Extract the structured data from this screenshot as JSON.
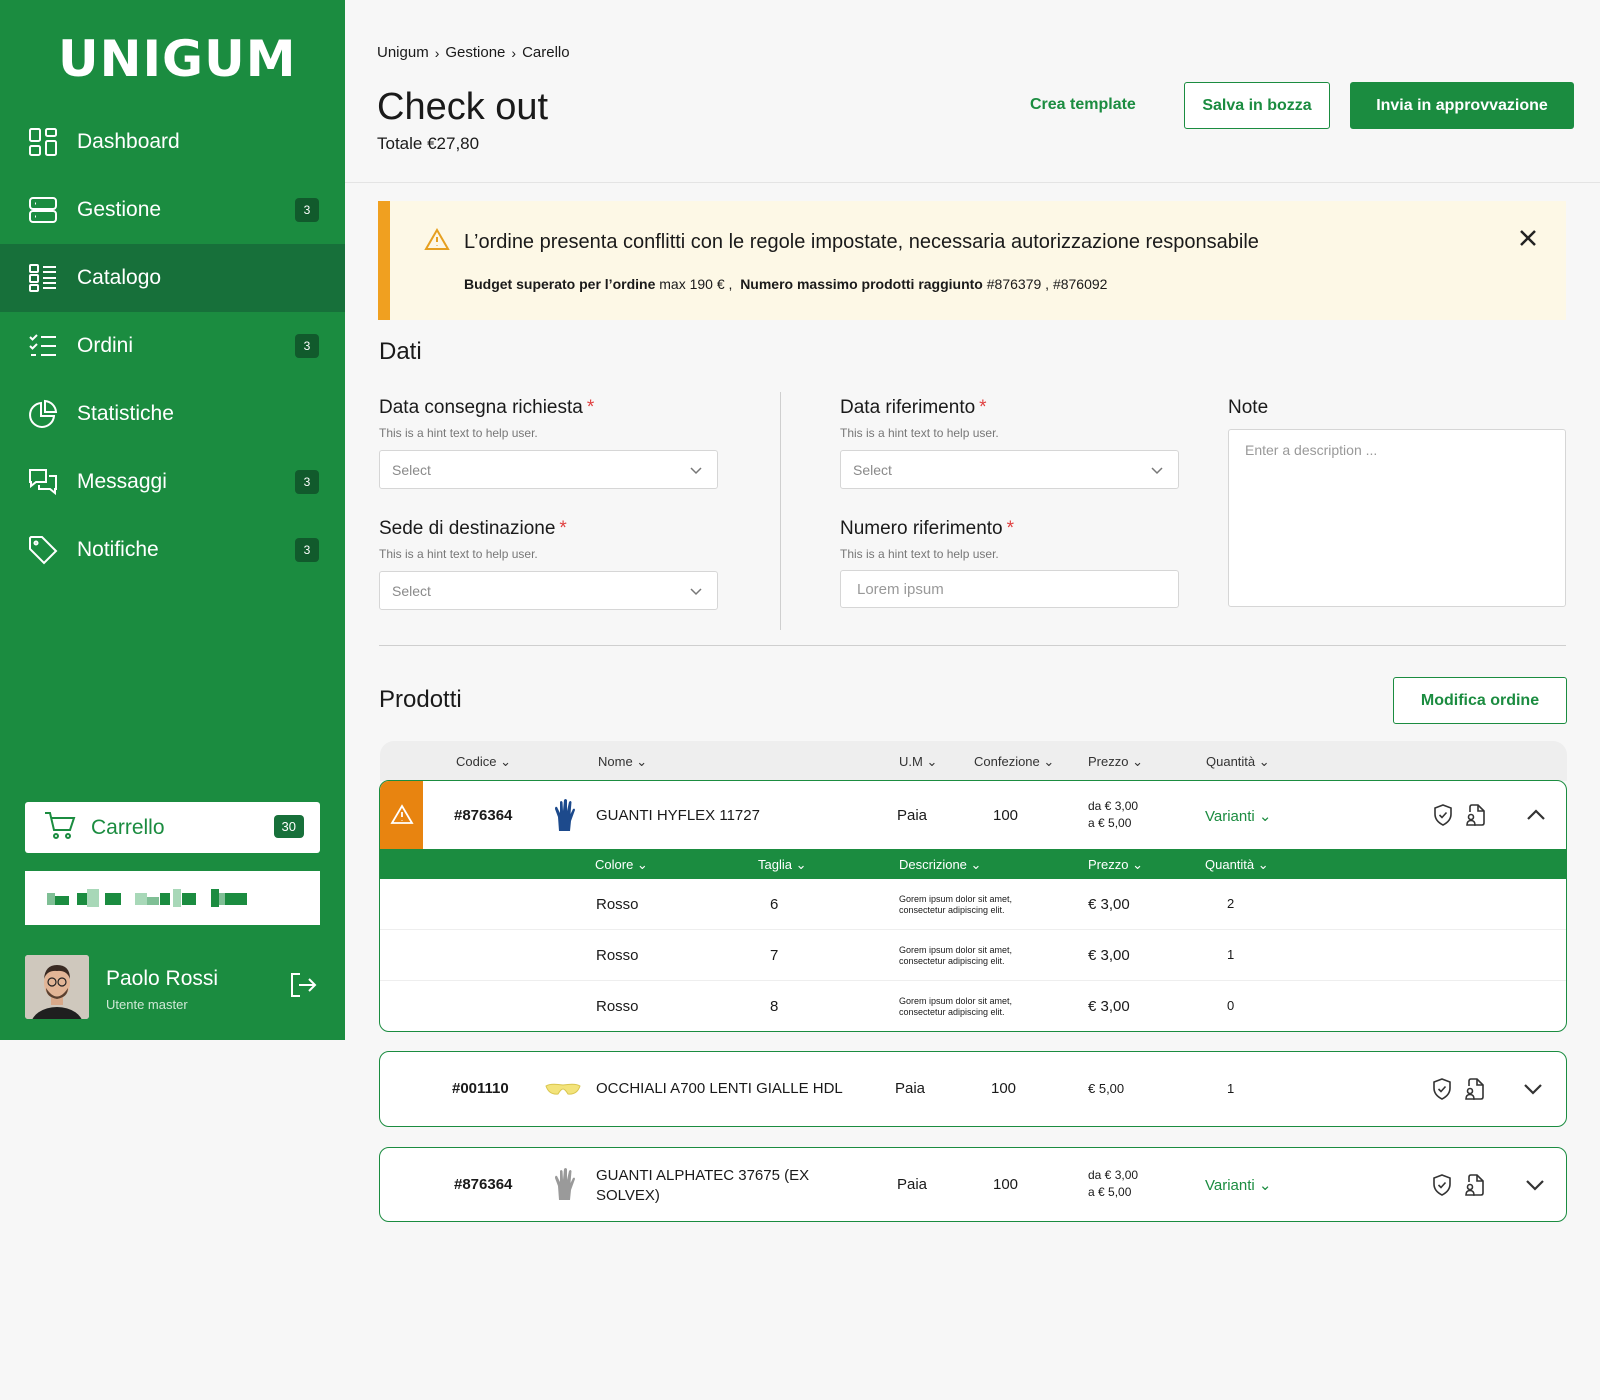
{
  "brand": {
    "logo": "UNIGUM",
    "accent": "#1b8c40"
  },
  "sidebar": {
    "items": [
      {
        "label": "Dashboard",
        "icon": "dashboard-icon",
        "badge": ""
      },
      {
        "label": "Gestione",
        "icon": "server-icon",
        "badge": "3"
      },
      {
        "label": "Catalogo",
        "icon": "list-icon",
        "badge": "",
        "active": true
      },
      {
        "label": "Ordini",
        "icon": "checklist-icon",
        "badge": "3"
      },
      {
        "label": "Statistiche",
        "icon": "pie-chart-icon",
        "badge": ""
      },
      {
        "label": "Messaggi",
        "icon": "chat-icon",
        "badge": "3"
      },
      {
        "label": "Notifiche",
        "icon": "tag-icon",
        "badge": "3"
      }
    ],
    "cart": {
      "label": "Carrello",
      "count": "30"
    },
    "user": {
      "name": "Paolo Rossi",
      "role": "Utente master"
    }
  },
  "header": {
    "breadcrumb": [
      "Unigum",
      "Gestione",
      "Carello"
    ],
    "title": "Check out",
    "total": "Totale €27,80",
    "actions": {
      "template": "Crea template",
      "draft": "Salva in bozza",
      "submit": "Invia in approvvazione"
    }
  },
  "alert": {
    "title": "L’ordine presenta conflitti con le regole impostate, necessaria autorizzazione responsabile",
    "budget_label": "Budget superato per l’ordine",
    "budget_value": "max 190 € ,",
    "max_label": "Numero massimo prodotti raggiunto",
    "max_value": "#876379 ,  #876092"
  },
  "dati": {
    "title": "Dati",
    "data_consegna": {
      "label": "Data consegna richiesta",
      "hint": "This is a hint text to help user.",
      "placeholder": "Select"
    },
    "sede": {
      "label": "Sede di destinazione",
      "hint": "This is a hint text to help user.",
      "placeholder": "Select"
    },
    "data_riferimento": {
      "label": "Data riferimento",
      "hint": "This is a hint text to help user.",
      "placeholder": "Select"
    },
    "numero_riferimento": {
      "label": "Numero riferimento",
      "hint": "This is a hint text to help user.",
      "placeholder": "Lorem ipsum"
    },
    "note": {
      "label": "Note",
      "placeholder": "Enter a description ..."
    }
  },
  "prodotti": {
    "title": "Prodotti",
    "edit_button": "Modifica ordine",
    "columns": [
      "Codice",
      "Nome",
      "U.M",
      "Confezione",
      "Prezzo",
      "Quantità"
    ],
    "sub_columns": [
      "Colore",
      "Taglia",
      "Descrizione",
      "Prezzo",
      "Quantità"
    ],
    "rows": [
      {
        "code": "#876364",
        "name": "GUANTI HYFLEX 11727",
        "um": "Paia",
        "pack": "100",
        "price_from": "da € 3,00",
        "price_to": "a € 5,00",
        "qty": "Varianti",
        "variants": [
          {
            "color": "Rosso",
            "size": "6",
            "desc1": "Gorem ipsum dolor sit amet,",
            "desc2": "consectetur adipiscing elit.",
            "price": "€ 3,00",
            "qty": "2"
          },
          {
            "color": "Rosso",
            "size": "7",
            "desc1": "Gorem ipsum dolor sit amet,",
            "desc2": "consectetur adipiscing elit.",
            "price": "€ 3,00",
            "qty": "1"
          },
          {
            "color": "Rosso",
            "size": "8",
            "desc1": "Gorem ipsum dolor sit amet,",
            "desc2": "consectetur adipiscing elit.",
            "price": "€ 3,00",
            "qty": "0"
          }
        ]
      },
      {
        "code": "#001110",
        "name": "OCCHIALI A700 LENTI GIALLE HDL",
        "um": "Paia",
        "pack": "100",
        "price": "€ 5,00",
        "qty": "1"
      },
      {
        "code": "#876364",
        "name1": "GUANTI ALPHATEC 37675 (EX",
        "name2": "SOLVEX)",
        "um": "Paia",
        "pack": "100",
        "price_from": "da € 3,00",
        "price_to": "a € 5,00",
        "qty": "Varianti"
      }
    ]
  }
}
